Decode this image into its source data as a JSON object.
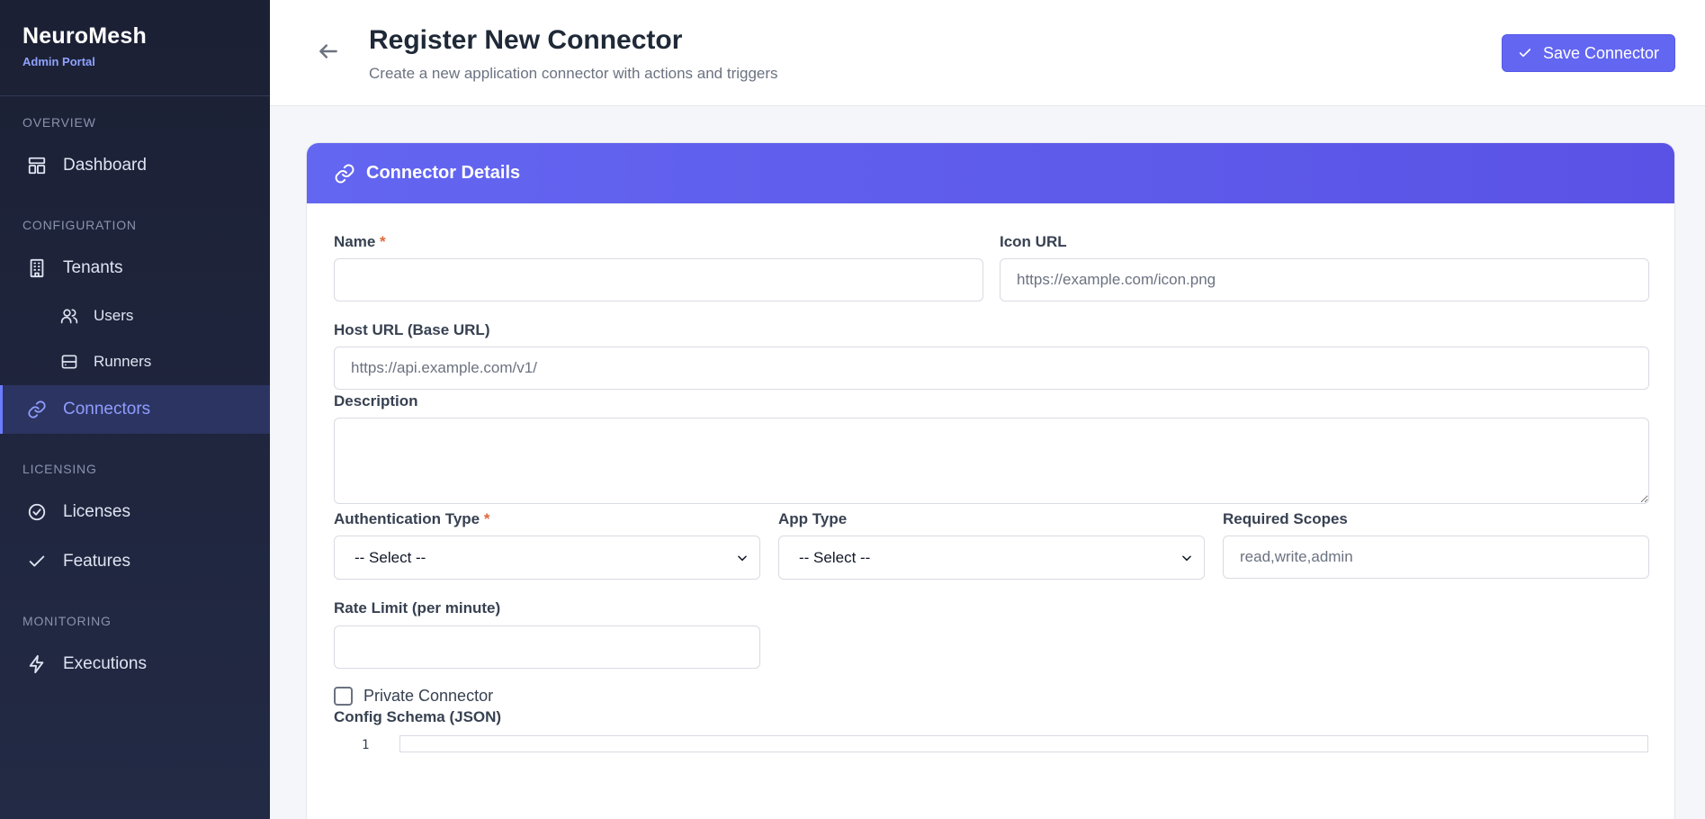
{
  "brand": {
    "name": "NeuroMesh",
    "subtitle": "Admin Portal"
  },
  "sidebar": {
    "sections": [
      {
        "label": "OVERVIEW"
      },
      {
        "label": "CONFIGURATION"
      },
      {
        "label": "LICENSING"
      },
      {
        "label": "MONITORING"
      }
    ],
    "items": [
      {
        "label": "Dashboard",
        "icon": "dashboard-icon"
      },
      {
        "label": "Tenants",
        "icon": "building-icon"
      },
      {
        "label": "Users",
        "icon": "users-icon"
      },
      {
        "label": "Runners",
        "icon": "server-icon"
      },
      {
        "label": "Connectors",
        "icon": "link-icon",
        "active": true
      },
      {
        "label": "Licenses",
        "icon": "check-circle-icon"
      },
      {
        "label": "Features",
        "icon": "check-icon"
      },
      {
        "label": "Executions",
        "icon": "lightning-icon"
      }
    ]
  },
  "header": {
    "title": "Register New Connector",
    "subtitle": "Create a new application connector with actions and triggers",
    "save_label": "Save Connector"
  },
  "card": {
    "title": "Connector Details"
  },
  "form": {
    "name": {
      "label": "Name",
      "required_mark": "*",
      "value": "",
      "placeholder": ""
    },
    "icon_url": {
      "label": "Icon URL",
      "value": "",
      "placeholder": "https://example.com/icon.png"
    },
    "host_url": {
      "label": "Host URL (Base URL)",
      "value": "",
      "placeholder": "https://api.example.com/v1/"
    },
    "description": {
      "label": "Description",
      "value": ""
    },
    "auth_type": {
      "label": "Authentication Type",
      "required_mark": "*",
      "selected": "-- Select --"
    },
    "app_type": {
      "label": "App Type",
      "selected": "-- Select --"
    },
    "scopes": {
      "label": "Required Scopes",
      "value": "",
      "placeholder": "read,write,admin"
    },
    "rate_limit": {
      "label": "Rate Limit (per minute)",
      "value": ""
    },
    "private": {
      "label": "Private Connector",
      "checked": false
    },
    "config_schema": {
      "label": "Config Schema (JSON)",
      "line_number": "1"
    }
  },
  "colors": {
    "accent": "#6366f1",
    "sidebar_bg": "#1b2034",
    "active_text": "#8f9dff",
    "required": "#e0683a"
  }
}
